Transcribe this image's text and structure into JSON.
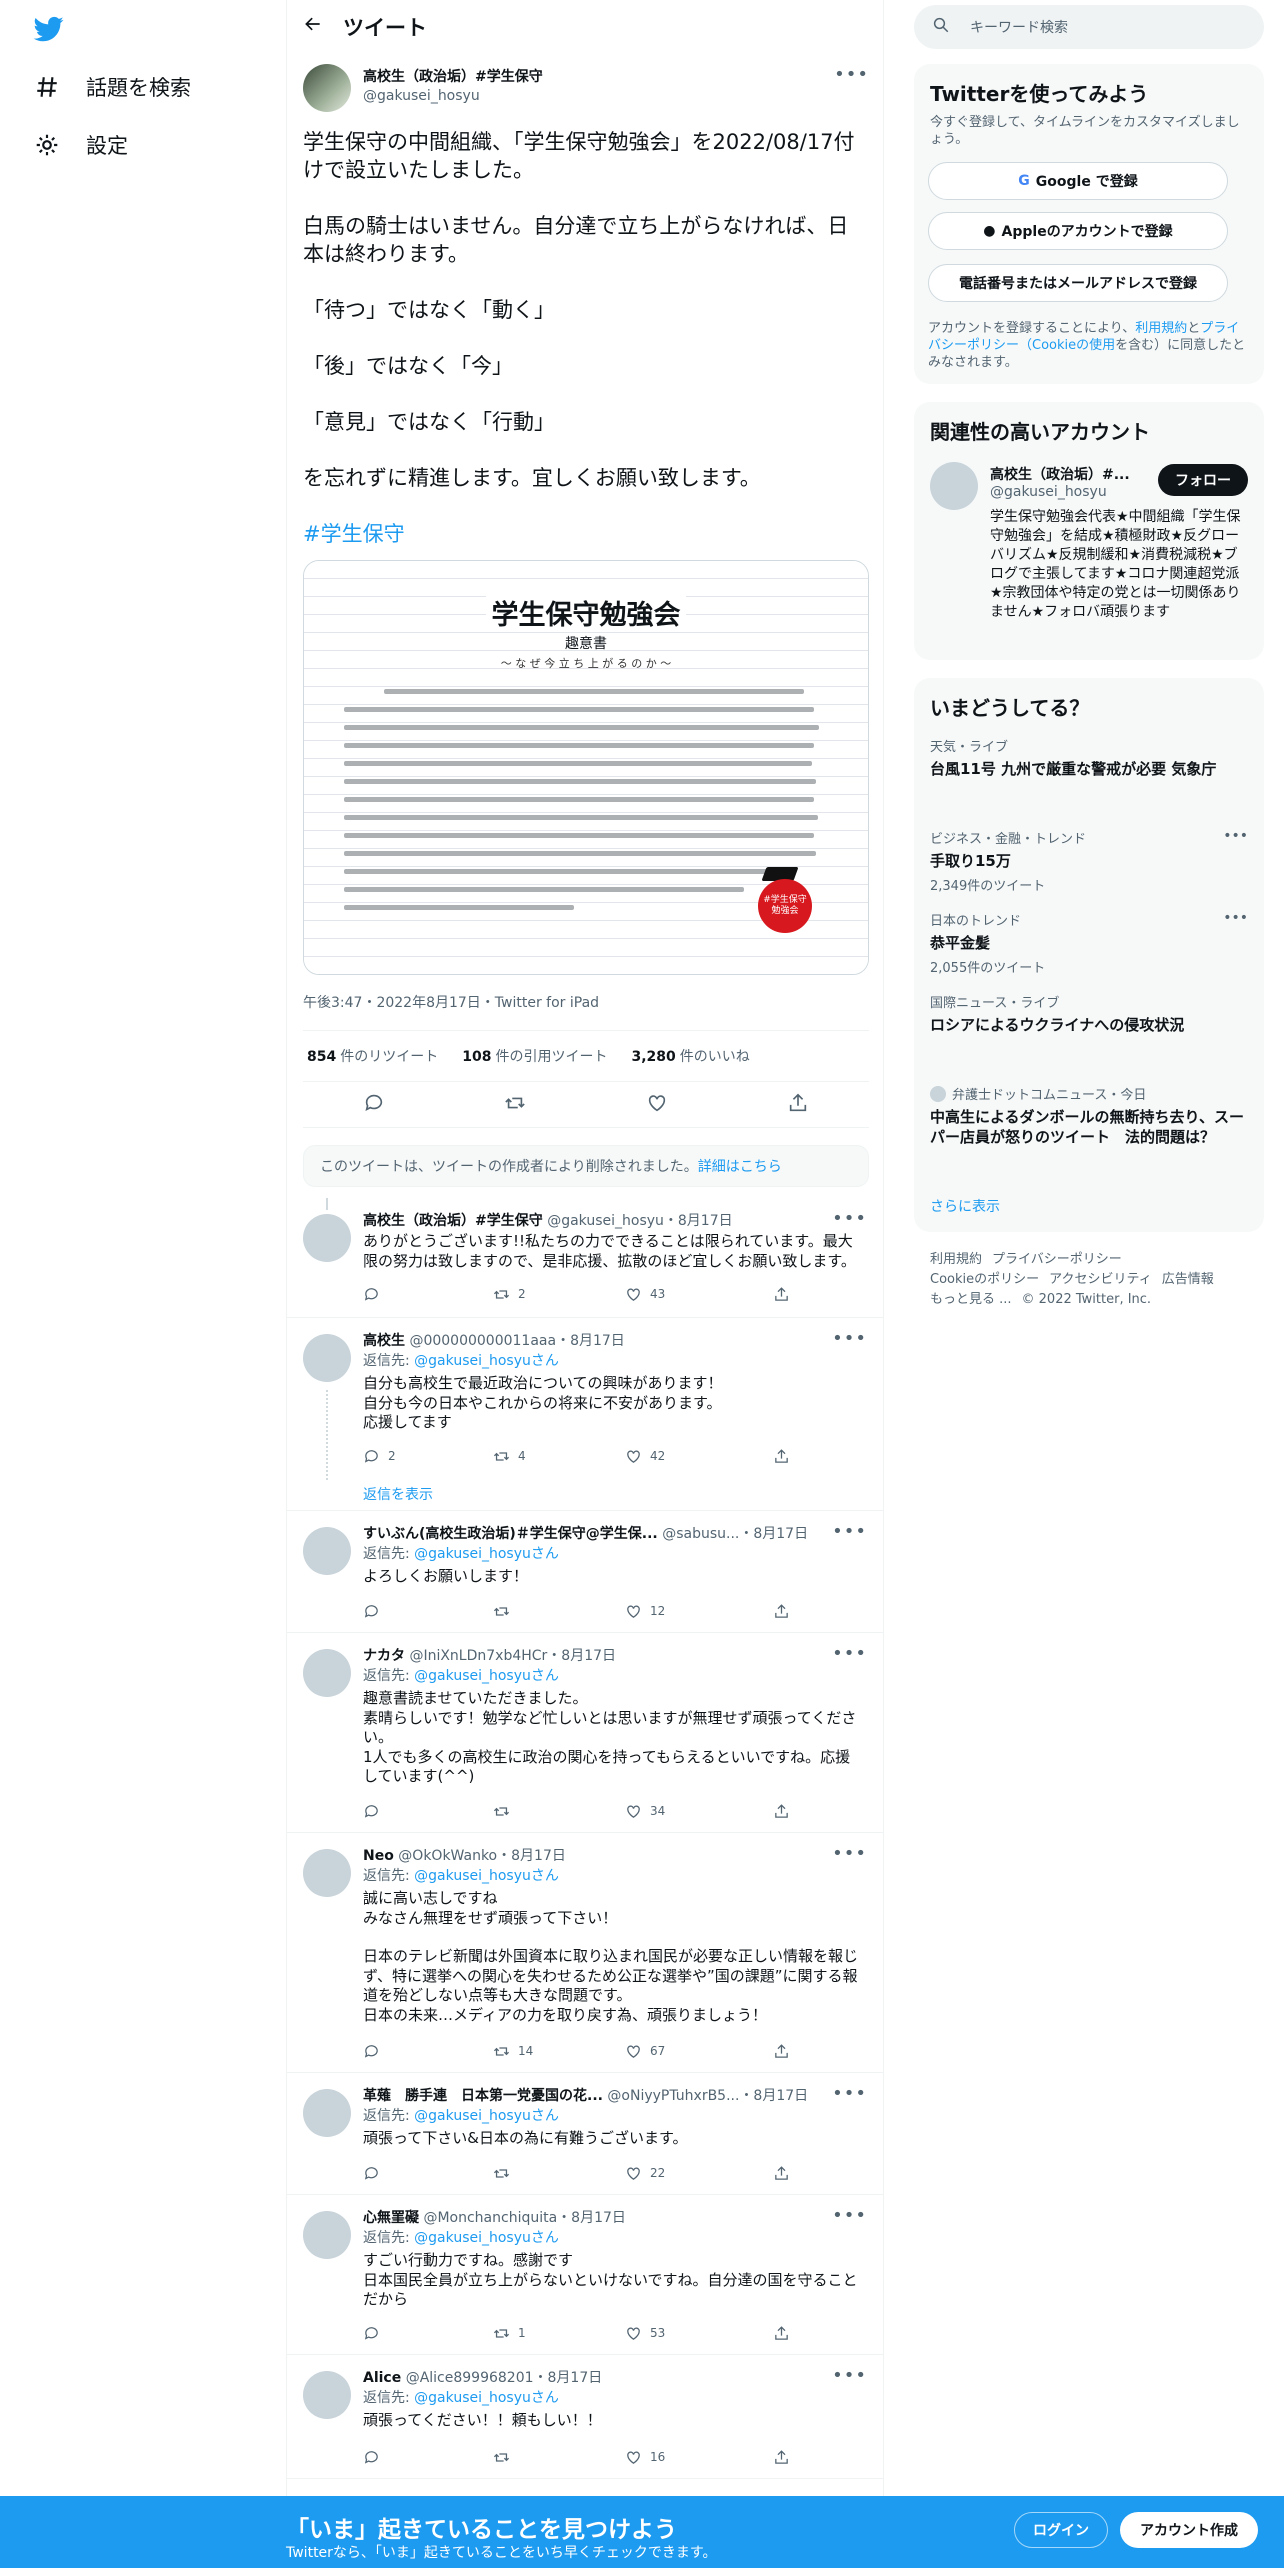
{
  "nav": {
    "explore": "話題を検索",
    "settings": "設定"
  },
  "header": {
    "title": "ツイート"
  },
  "main_tweet": {
    "name": "高校生（政治垢）#学生保守",
    "handle": "@gakusei_hosyu",
    "paragraphs": [
      "学生保守の中間組織、「学生保守勉強会」を2022/08/17付けで設立いたしました。",
      "白馬の騎士はいません。自分達で立ち上がらなければ、日本は終わります。",
      "「待つ」ではなく「動く」",
      "「後」ではなく「今」",
      "「意見」ではなく「行動」",
      "を忘れずに精進します。宜しくお願い致します。"
    ],
    "hashtag": "#学生保守",
    "image": {
      "title": "学生保守勉強会",
      "subtitle": "趣意書",
      "tagline": "〜 な ぜ 今 立 ち 上 が る の か 〜",
      "stamp": "#学生保守\n勉強会"
    },
    "meta": "午後3:47・2022年8月17日・Twitter for iPad",
    "retweets": "854",
    "retweets_label": "件のリツイート",
    "quotes": "108",
    "quotes_label": "件の引用ツイート",
    "likes": "3,280",
    "likes_label": "件のいいね"
  },
  "deleted_notice": {
    "text": "このツイートは、ツイートの作成者により削除されました。",
    "link": "詳細はこちら"
  },
  "replies": [
    {
      "name": "高校生（政治垢）#学生保守",
      "handle": "@gakusei_hosyu・8月17日",
      "reply_to": "",
      "lines": [
        "ありがとうございます!!私たちの力でできることは限られています。最大限の努力は致しますので、是非応援、拡散のほど宜しくお願い致します。"
      ],
      "replies": "",
      "retweets": "2",
      "likes": "43"
    },
    {
      "name": "高校生",
      "handle": "@000000000011aaa・8月17日",
      "reply_to": "@gakusei_hosyuさん",
      "lines": [
        "自分も高校生で最近政治についての興味があります！",
        "自分も今の日本やこれからの将来に不安があります。",
        "応援してます"
      ],
      "replies": "2",
      "retweets": "4",
      "likes": "42",
      "show_replies": "返信を表示"
    },
    {
      "name": "すいぶん(高校生政治垢)＃学生保守@学生保...",
      "handle": "@sabusu...・8月17日",
      "reply_to": "@gakusei_hosyuさん",
      "lines": [
        "よろしくお願いします！"
      ],
      "replies": "",
      "retweets": "",
      "likes": "12"
    },
    {
      "name": "ナカタ",
      "handle": "@IniXnLDn7xb4HCr・8月17日",
      "reply_to": "@gakusei_hosyuさん",
      "lines": [
        "趣意書読ませていただきました。",
        "素晴らしいです！勉学など忙しいとは思いますが無理せず頑張ってください。",
        "1人でも多くの高校生に政治の関心を持ってもらえるといいですね。応援しています(^^)"
      ],
      "replies": "",
      "retweets": "",
      "likes": "34"
    },
    {
      "name": "Neo",
      "handle": "@OkOkWanko・8月17日",
      "reply_to": "@gakusei_hosyuさん",
      "lines": [
        "誠に高い志しですね",
        "みなさん無理をせず頑張って下さい！",
        "",
        "日本のテレビ新聞は外国資本に取り込まれ国民が必要な正しい情報を報じず、特に選挙への関心を失わせるため公正な選挙や”国の課題”に関する報道を殆どしない点等も大きな問題です。",
        "日本の未来…メディアの力を取り戻す為、頑張りましょう！"
      ],
      "replies": "",
      "retweets": "14",
      "likes": "67"
    },
    {
      "name": "革薙　勝手連　日本第一党憂国の花...",
      "handle": "@oNiyyPTuhxrB5...・8月17日",
      "reply_to": "@gakusei_hosyuさん",
      "lines": [
        "頑張って下さい&日本の為に有難うございます。"
      ],
      "replies": "",
      "retweets": "",
      "likes": "22"
    },
    {
      "name": "心無罣礙",
      "handle": "@Monchanchiquita・8月17日",
      "reply_to": "@gakusei_hosyuさん",
      "lines": [
        "すごい行動力ですね。感謝です",
        "日本国民全員が立ち上がらないといけないですね。自分達の国を守ることだから"
      ],
      "replies": "",
      "retweets": "1",
      "likes": "53"
    },
    {
      "name": "Alice",
      "handle": "@Alice899968201・8月17日",
      "reply_to": "@gakusei_hosyuさん",
      "lines": [
        "頑張ってください！！頼もしい！！"
      ],
      "replies": "",
      "retweets": "",
      "likes": "16"
    }
  ],
  "reply_to_prefix": "返信先: ",
  "right": {
    "search_placeholder": "キーワード検索",
    "signup": {
      "title": "Twitterを使ってみよう",
      "desc": "今すぐ登録して、タイムラインをカスタマイズしましょう。",
      "google": "Google で登録",
      "apple": "Appleのアカウントで登録",
      "phone": "電話番号またはメールアドレスで登録",
      "terms_pre": "アカウントを登録することにより、",
      "terms_link1": "利用規約",
      "terms_mid": "と",
      "terms_link2": "プライバシーポリシー（Cookieの使用",
      "terms_post": "を含む）に同意したとみなされます。"
    },
    "related": {
      "title": "関連性の高いアカウント",
      "name": "高校生（政治垢）#...",
      "handle": "@gakusei_hosyu",
      "follow": "フォロー",
      "bio": "学生保守勉強会代表★中間組織「学生保守勉強会」を結成★積極財政★反グローバリズム★反規制緩和★消費税減税★ブログで主張してます★コロナ関連超党派★宗教団体や特定の党とは一切関係ありません★フォロバ頑張ります"
    },
    "trends": {
      "title": "いまどうしてる？",
      "items": [
        {
          "cat": "天気・ライブ",
          "title": "台風11号 九州で厳重な警戒が必要 気象庁",
          "count": ""
        },
        {
          "cat": "ビジネス・金融・トレンド",
          "title": "手取り15万",
          "count": "2,349件のツイート"
        },
        {
          "cat": "日本のトレンド",
          "title": "恭平金髪",
          "count": "2,055件のツイート"
        },
        {
          "cat": "国際ニュース・ライブ",
          "title": "ロシアによるウクライナへの侵攻状況",
          "count": ""
        },
        {
          "cat": "弁護士ドットコムニュース・今日",
          "title": "中高生によるダンボールの無断持ち去り、スーパー店員が怒りのツイート　法的問題は？",
          "count": ""
        }
      ],
      "more": "さらに表示"
    },
    "footer": {
      "line1": [
        "利用規約",
        "プライバシーポリシー"
      ],
      "line2": [
        "Cookieのポリシー",
        "アクセシビリティ",
        "広告情報"
      ],
      "line3": [
        "もっと見る ...",
        "© 2022 Twitter, Inc."
      ]
    }
  },
  "bottombar": {
    "title": "「いま」起きていることを見つけよう",
    "sub": "Twitterなら、「いま」起きていることをいち早くチェックできます。",
    "login": "ログイン",
    "signup": "アカウント作成"
  },
  "colors": {
    "accent": "#1d9bf0",
    "text": "#0f1419",
    "muted": "#536471"
  }
}
